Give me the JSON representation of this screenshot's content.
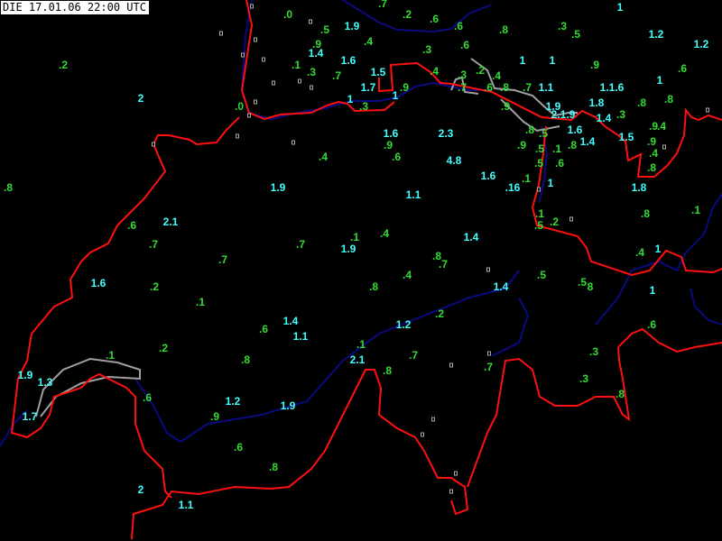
{
  "header": {
    "title": "DIE 17.01.06 22:00 UTC"
  },
  "colors": {
    "cyan": "#40ffff",
    "green": "#33dd33",
    "border": "#ff1010",
    "river": "#0a0a80",
    "lake": "#a0a0a0"
  },
  "stations": [
    {
      "v": ".7",
      "c": "green"
    },
    {
      "v": "1",
      "c": "cyan"
    },
    {
      "v": ".0",
      "c": "green"
    },
    {
      "v": ".2",
      "c": "green"
    },
    {
      "v": ".6",
      "c": "green"
    },
    {
      "v": "1.9",
      "c": "cyan"
    },
    {
      "v": ".5",
      "c": "green"
    },
    {
      "v": ".6",
      "c": "green"
    },
    {
      "v": ".8",
      "c": "green"
    },
    {
      "v": ".3",
      "c": "green"
    },
    {
      "v": ".5",
      "c": "green"
    },
    {
      "v": "1.2",
      "c": "cyan"
    },
    {
      "v": ".4",
      "c": "green"
    },
    {
      "v": ".9",
      "c": "green"
    },
    {
      "v": "1.4",
      "c": "cyan"
    },
    {
      "v": ".3",
      "c": "green"
    },
    {
      "v": ".6",
      "c": "green"
    },
    {
      "v": "1.2",
      "c": "cyan"
    },
    {
      "v": ".2",
      "c": "green"
    },
    {
      "v": "1.6",
      "c": "cyan"
    },
    {
      "v": ".1",
      "c": "green"
    },
    {
      "v": ".3",
      "c": "green"
    },
    {
      "v": ".7",
      "c": "green"
    },
    {
      "v": "1.5",
      "c": "cyan"
    },
    {
      "v": ".4",
      "c": "green"
    },
    {
      "v": ".3",
      "c": "green"
    },
    {
      "v": ".2",
      "c": "green"
    },
    {
      "v": ".4",
      "c": "green"
    },
    {
      "v": "1",
      "c": "cyan"
    },
    {
      "v": "1",
      "c": "cyan"
    },
    {
      "v": ".9",
      "c": "green"
    },
    {
      "v": ".6",
      "c": "green"
    },
    {
      "v": "1",
      "c": "cyan"
    },
    {
      "v": "2",
      "c": "cyan"
    },
    {
      "v": "1.7",
      "c": "cyan"
    },
    {
      "v": ".9",
      "c": "green"
    },
    {
      "v": "1",
      "c": "cyan"
    },
    {
      "v": ".7",
      "c": "green"
    },
    {
      "v": ".6",
      "c": "green"
    },
    {
      "v": ".8",
      "c": "green"
    },
    {
      "v": ".7",
      "c": "green"
    },
    {
      "v": "1.1",
      "c": "cyan"
    },
    {
      "v": "1.1.6",
      "c": "cyan"
    },
    {
      "v": "1",
      "c": "cyan"
    },
    {
      "v": ".3",
      "c": "green"
    },
    {
      "v": ".0",
      "c": "green"
    },
    {
      "v": "1.9",
      "c": "cyan"
    },
    {
      "v": ".8",
      "c": "green"
    },
    {
      "v": ".8",
      "c": "green"
    },
    {
      "v": "2.1.9",
      "c": "cyan"
    },
    {
      "v": ".9",
      "c": "green"
    },
    {
      "v": "1.8",
      "c": "cyan"
    },
    {
      "v": "1.4",
      "c": "cyan"
    },
    {
      "v": ".3",
      "c": "green"
    },
    {
      "v": ".8",
      "c": "green"
    },
    {
      "v": ".5",
      "c": "green"
    },
    {
      "v": "1.6",
      "c": "cyan"
    },
    {
      "v": ".9",
      "c": "green"
    },
    {
      "v": ".4",
      "c": "green"
    },
    {
      "v": "1.6",
      "c": "cyan"
    },
    {
      "v": "2.3",
      "c": "cyan"
    },
    {
      "v": "1.4",
      "c": "cyan"
    },
    {
      "v": "1.5",
      "c": "cyan"
    },
    {
      "v": ".9",
      "c": "green"
    },
    {
      "v": ".5",
      "c": "green"
    },
    {
      "v": ".1",
      "c": "green"
    },
    {
      "v": ".8",
      "c": "green"
    },
    {
      "v": ".9",
      "c": "green"
    },
    {
      "v": ".9",
      "c": "green"
    },
    {
      "v": ".4",
      "c": "green"
    },
    {
      "v": ".6",
      "c": "green"
    },
    {
      "v": ".4",
      "c": "green"
    },
    {
      "v": "4.8",
      "c": "cyan"
    },
    {
      "v": ".5",
      "c": "green"
    },
    {
      "v": ".6",
      "c": "green"
    },
    {
      "v": ".8",
      "c": "green"
    },
    {
      "v": ".8",
      "c": "green"
    },
    {
      "v": "1.9",
      "c": "cyan"
    },
    {
      "v": "1.6",
      "c": "cyan"
    },
    {
      "v": ".1",
      "c": "green"
    },
    {
      "v": ".16",
      "c": "cyan"
    },
    {
      "v": "1",
      "c": "cyan"
    },
    {
      "v": "1.8",
      "c": "cyan"
    },
    {
      "v": "1.1",
      "c": "cyan"
    },
    {
      "v": ".1",
      "c": "green"
    },
    {
      "v": ".2",
      "c": "green"
    },
    {
      "v": ".8",
      "c": "green"
    },
    {
      "v": ".1",
      "c": "green"
    },
    {
      "v": "2.1",
      "c": "cyan"
    },
    {
      "v": ".6",
      "c": "green"
    },
    {
      "v": ".5",
      "c": "green"
    },
    {
      "v": ".1",
      "c": "green"
    },
    {
      "v": ".4",
      "c": "green"
    },
    {
      "v": "1.4",
      "c": "cyan"
    },
    {
      "v": ".7",
      "c": "green"
    },
    {
      "v": ".7",
      "c": "green"
    },
    {
      "v": "1.9",
      "c": "cyan"
    },
    {
      "v": "1",
      "c": "cyan"
    },
    {
      "v": ".4",
      "c": "green"
    },
    {
      "v": ".8",
      "c": "green"
    },
    {
      "v": ".7",
      "c": "green"
    },
    {
      "v": ".7",
      "c": "green"
    },
    {
      "v": ".4",
      "c": "green"
    },
    {
      "v": ".5",
      "c": "green"
    },
    {
      "v": ".5",
      "c": "green"
    },
    {
      "v": "8",
      "c": "green"
    },
    {
      "v": "1.6",
      "c": "cyan"
    },
    {
      "v": ".2",
      "c": "green"
    },
    {
      "v": ".8",
      "c": "green"
    },
    {
      "v": "1.4",
      "c": "cyan"
    },
    {
      "v": "1",
      "c": "cyan"
    },
    {
      "v": ".1",
      "c": "green"
    },
    {
      "v": "1.4",
      "c": "cyan"
    },
    {
      "v": ".2",
      "c": "green"
    },
    {
      "v": "1.2",
      "c": "cyan"
    },
    {
      "v": ".6",
      "c": "green"
    },
    {
      "v": ".6",
      "c": "green"
    },
    {
      "v": "1.1",
      "c": "cyan"
    },
    {
      "v": ".1",
      "c": "green"
    },
    {
      "v": ".2",
      "c": "green"
    },
    {
      "v": ".1",
      "c": "green"
    },
    {
      "v": ".3",
      "c": "green"
    },
    {
      "v": ".8",
      "c": "green"
    },
    {
      "v": ".7",
      "c": "green"
    },
    {
      "v": "2.1",
      "c": "cyan"
    },
    {
      "v": ".8",
      "c": "green"
    },
    {
      "v": ".7",
      "c": "green"
    },
    {
      "v": "1.9",
      "c": "cyan"
    },
    {
      "v": "1.3",
      "c": "cyan"
    },
    {
      "v": ".3",
      "c": "green"
    },
    {
      "v": ".6",
      "c": "green"
    },
    {
      "v": ".8",
      "c": "green"
    },
    {
      "v": "1.2",
      "c": "cyan"
    },
    {
      "v": "1.9",
      "c": "cyan"
    },
    {
      "v": "1.7",
      "c": "cyan"
    },
    {
      "v": ".9",
      "c": "green"
    },
    {
      "v": ".6",
      "c": "green"
    },
    {
      "v": ".8",
      "c": "green"
    },
    {
      "v": "2",
      "c": "cyan"
    },
    {
      "v": "1.1",
      "c": "cyan"
    }
  ]
}
